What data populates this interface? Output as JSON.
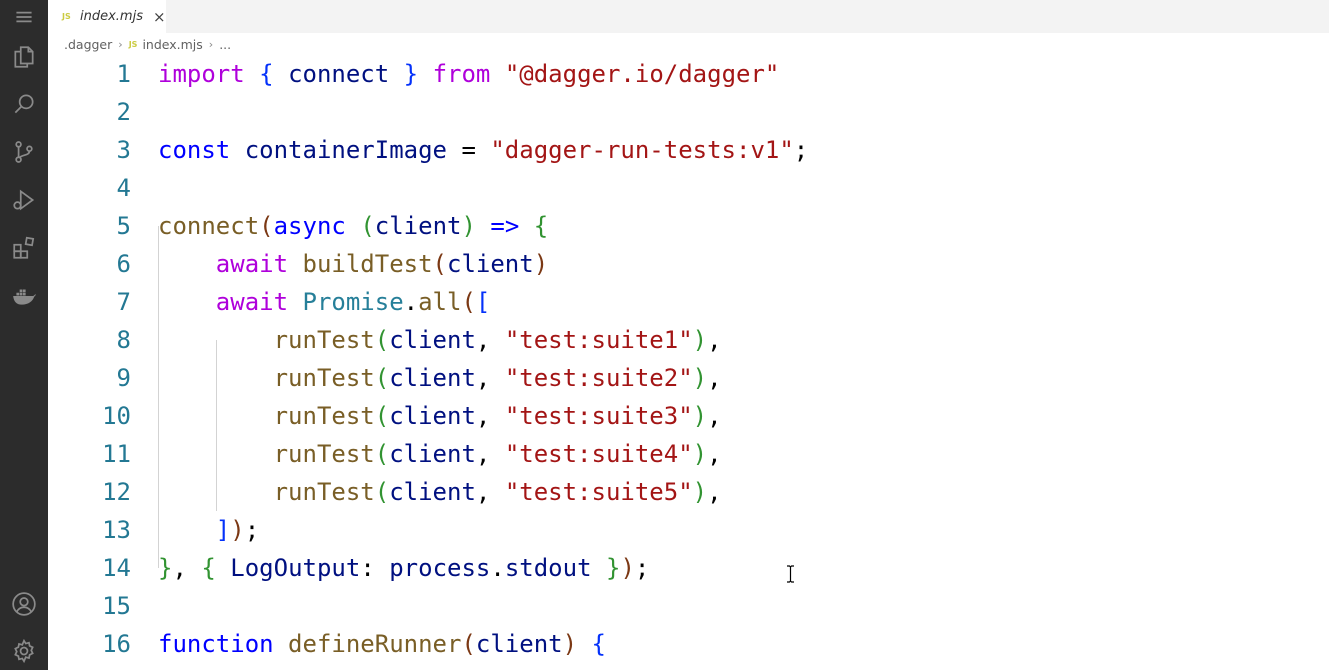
{
  "tab": {
    "icon_label": "JS",
    "label": "index.mjs",
    "close_glyph": "×"
  },
  "breadcrumb": {
    "folder": ".dagger",
    "sep1": "›",
    "js_badge": "JS",
    "file": "index.mjs",
    "sep2": "›",
    "more": "..."
  },
  "activity_bar": [
    "menu-icon",
    "explorer-icon",
    "search-icon",
    "source-control-icon",
    "run-debug-icon",
    "extensions-icon",
    "docker-icon",
    "account-icon",
    "settings-gear-icon"
  ],
  "lines": [
    {
      "n": "1",
      "tokens": [
        [
          "kw-ctrl",
          "import"
        ],
        [
          "pl",
          " "
        ],
        [
          "b1",
          "{"
        ],
        [
          "pl",
          " "
        ],
        [
          "var",
          "connect"
        ],
        [
          "pl",
          " "
        ],
        [
          "b1",
          "}"
        ],
        [
          "pl",
          " "
        ],
        [
          "kw-ctrl",
          "from"
        ],
        [
          "pl",
          " "
        ],
        [
          "str",
          "\"@dagger.io/dagger\""
        ]
      ]
    },
    {
      "n": "2",
      "tokens": []
    },
    {
      "n": "3",
      "tokens": [
        [
          "kw",
          "const"
        ],
        [
          "pl",
          " "
        ],
        [
          "var",
          "containerImage"
        ],
        [
          "pl",
          " = "
        ],
        [
          "str",
          "\"dagger-run-tests:v1\""
        ],
        [
          "pl",
          ";"
        ]
      ]
    },
    {
      "n": "4",
      "tokens": []
    },
    {
      "n": "5",
      "tokens": [
        [
          "fn",
          "connect"
        ],
        [
          "b3",
          "("
        ],
        [
          "kw",
          "async"
        ],
        [
          "pl",
          " "
        ],
        [
          "b2",
          "("
        ],
        [
          "var",
          "client"
        ],
        [
          "b2",
          ")"
        ],
        [
          "pl",
          " "
        ],
        [
          "kw",
          "=>"
        ],
        [
          "pl",
          " "
        ],
        [
          "b2",
          "{"
        ]
      ]
    },
    {
      "n": "6",
      "tokens": [
        [
          "pl",
          "    "
        ],
        [
          "kw-ctrl",
          "await"
        ],
        [
          "pl",
          " "
        ],
        [
          "fn",
          "buildTest"
        ],
        [
          "b3",
          "("
        ],
        [
          "var",
          "client"
        ],
        [
          "b3",
          ")"
        ]
      ]
    },
    {
      "n": "7",
      "tokens": [
        [
          "pl",
          "    "
        ],
        [
          "kw-ctrl",
          "await"
        ],
        [
          "pl",
          " "
        ],
        [
          "type",
          "Promise"
        ],
        [
          "pl",
          "."
        ],
        [
          "fn",
          "all"
        ],
        [
          "b3",
          "("
        ],
        [
          "b1",
          "["
        ]
      ]
    },
    {
      "n": "8",
      "tokens": [
        [
          "pl",
          "        "
        ],
        [
          "fn",
          "runTest"
        ],
        [
          "b2",
          "("
        ],
        [
          "var",
          "client"
        ],
        [
          "pl",
          ", "
        ],
        [
          "str",
          "\"test:suite1\""
        ],
        [
          "b2",
          ")"
        ],
        [
          "pl",
          ","
        ]
      ]
    },
    {
      "n": "9",
      "tokens": [
        [
          "pl",
          "        "
        ],
        [
          "fn",
          "runTest"
        ],
        [
          "b2",
          "("
        ],
        [
          "var",
          "client"
        ],
        [
          "pl",
          ", "
        ],
        [
          "str",
          "\"test:suite2\""
        ],
        [
          "b2",
          ")"
        ],
        [
          "pl",
          ","
        ]
      ]
    },
    {
      "n": "10",
      "tokens": [
        [
          "pl",
          "        "
        ],
        [
          "fn",
          "runTest"
        ],
        [
          "b2",
          "("
        ],
        [
          "var",
          "client"
        ],
        [
          "pl",
          ", "
        ],
        [
          "str",
          "\"test:suite3\""
        ],
        [
          "b2",
          ")"
        ],
        [
          "pl",
          ","
        ]
      ]
    },
    {
      "n": "11",
      "tokens": [
        [
          "pl",
          "        "
        ],
        [
          "fn",
          "runTest"
        ],
        [
          "b2",
          "("
        ],
        [
          "var",
          "client"
        ],
        [
          "pl",
          ", "
        ],
        [
          "str",
          "\"test:suite4\""
        ],
        [
          "b2",
          ")"
        ],
        [
          "pl",
          ","
        ]
      ]
    },
    {
      "n": "12",
      "tokens": [
        [
          "pl",
          "        "
        ],
        [
          "fn",
          "runTest"
        ],
        [
          "b2",
          "("
        ],
        [
          "var",
          "client"
        ],
        [
          "pl",
          ", "
        ],
        [
          "str",
          "\"test:suite5\""
        ],
        [
          "b2",
          ")"
        ],
        [
          "pl",
          ","
        ]
      ]
    },
    {
      "n": "13",
      "tokens": [
        [
          "pl",
          "    "
        ],
        [
          "b1",
          "]"
        ],
        [
          "b3",
          ")"
        ],
        [
          "pl",
          ";"
        ]
      ]
    },
    {
      "n": "14",
      "tokens": [
        [
          "b2",
          "}"
        ],
        [
          "pl",
          ", "
        ],
        [
          "b2",
          "{"
        ],
        [
          "pl",
          " "
        ],
        [
          "var",
          "LogOutput"
        ],
        [
          "pl",
          ": "
        ],
        [
          "var",
          "process"
        ],
        [
          "pl",
          "."
        ],
        [
          "var",
          "stdout"
        ],
        [
          "pl",
          " "
        ],
        [
          "b2",
          "}"
        ],
        [
          "b3",
          ")"
        ],
        [
          "pl",
          ";"
        ]
      ]
    },
    {
      "n": "15",
      "tokens": []
    },
    {
      "n": "16",
      "tokens": [
        [
          "kw",
          "function"
        ],
        [
          "pl",
          " "
        ],
        [
          "fn",
          "defineRunner"
        ],
        [
          "b3",
          "("
        ],
        [
          "var",
          "client"
        ],
        [
          "b3",
          ")"
        ],
        [
          "pl",
          " "
        ],
        [
          "b1",
          "{"
        ]
      ]
    }
  ]
}
